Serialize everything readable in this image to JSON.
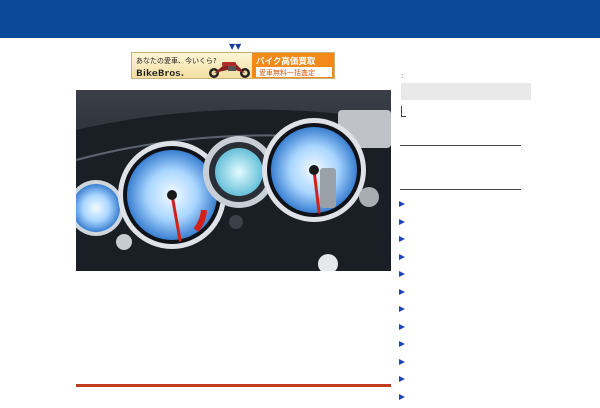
{
  "banner": {
    "arrow": "▼▼",
    "question": "あなたの愛車、今いくら?",
    "brand": "BikeBros.",
    "cta_main": "バイク高価買取",
    "cta_sub": "愛車無料一括査定"
  },
  "caption": "",
  "sidebar": {
    "mark": ":",
    "items": [
      "",
      "",
      "",
      "",
      "",
      "",
      "",
      "",
      "",
      "",
      "",
      ""
    ]
  },
  "colors": {
    "header": "#0b4a9a",
    "accent_red": "#c43c1e",
    "bullet": "#1f43b8"
  }
}
